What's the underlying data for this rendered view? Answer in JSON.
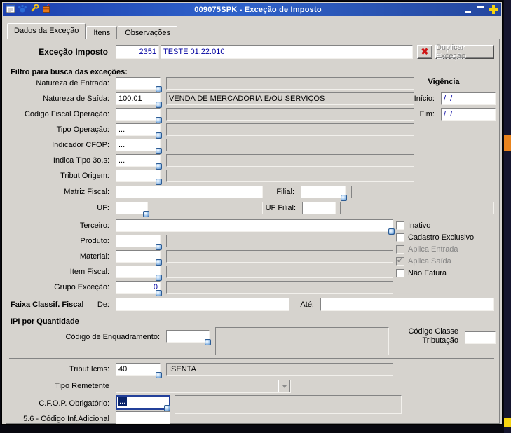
{
  "titlebar": {
    "title": "009075SPK - Exceção de Imposto"
  },
  "tabs": [
    {
      "label": "Dados da Exceção",
      "active": true
    },
    {
      "label": "Itens",
      "active": false
    },
    {
      "label": "Observações",
      "active": false
    }
  ],
  "header": {
    "label": "Exceção Imposto",
    "code": "2351",
    "description": "TESTE 01.22.010",
    "delete_icon": "✖",
    "duplicate_label": "Duplicar Exceção"
  },
  "sections": {
    "filtro": "Filtro para busca das exceções:",
    "vigencia": "Vigência",
    "faixa": "Faixa Classif. Fiscal",
    "ipi": "IPI por Quantidade"
  },
  "fields": {
    "natureza_entrada": {
      "label": "Natureza de Entrada:",
      "code": "",
      "desc": ""
    },
    "natureza_saida": {
      "label": "Natureza de Saída:",
      "code": "100.01",
      "desc": "VENDA DE MERCADORIA E/OU SERVIÇOS"
    },
    "inicio": {
      "label": "Início:",
      "value": "/  /"
    },
    "fim": {
      "label": "Fim:",
      "value": "/  /"
    },
    "codigo_fiscal_operacao": {
      "label": "Código Fiscal Operação:",
      "code": "",
      "desc": ""
    },
    "tipo_operacao": {
      "label": "Tipo Operação:",
      "code": "...",
      "desc": ""
    },
    "indicador_cfop": {
      "label": "Indicador CFOP:",
      "code": "...",
      "desc": ""
    },
    "indica_tipo_3os": {
      "label": "Indica Tipo 3o.s:",
      "code": "...",
      "desc": ""
    },
    "tribut_origem": {
      "label": "Tribut Origem:",
      "code": "",
      "desc": ""
    },
    "matriz_fiscal": {
      "label": "Matriz Fiscal:",
      "value": ""
    },
    "filial": {
      "label": "Filial:",
      "code": "",
      "desc": ""
    },
    "uf": {
      "label": "UF:",
      "code": "",
      "desc": ""
    },
    "uf_filial": {
      "label": "UF Filial:",
      "code": "",
      "desc": ""
    },
    "terceiro": {
      "label": "Terceiro:",
      "value": ""
    },
    "produto": {
      "label": "Produto:",
      "code": "",
      "desc": ""
    },
    "material": {
      "label": "Material:",
      "code": "",
      "desc": ""
    },
    "item_fiscal": {
      "label": "Item Fiscal:",
      "code": "",
      "desc": ""
    },
    "grupo_excecao": {
      "label": "Grupo Exceção:",
      "code": "0",
      "desc": ""
    },
    "faixa_de": {
      "label": "De:",
      "value": ""
    },
    "faixa_ate": {
      "label": "Até:",
      "value": ""
    },
    "codigo_enquadramento": {
      "label": "Código de Enquadramento:",
      "code": "",
      "desc": ""
    },
    "codigo_classe_tributacao": {
      "label": "Código Classe Tributação",
      "value": ""
    },
    "tribut_icms": {
      "label": "Tribut Icms:",
      "code": "40",
      "desc": "ISENTA"
    },
    "tipo_remetente": {
      "label": "Tipo Remetente",
      "value": ""
    },
    "cfop_obrigatorio": {
      "label": "C.F.O.P. Obrigatório:",
      "code": "...",
      "desc": ""
    },
    "codigo_inf_adicional": {
      "label": "5.6 - Código Inf.Adicional",
      "value": ""
    }
  },
  "checkboxes": [
    {
      "label": "Inativo",
      "checked": false,
      "disabled": false
    },
    {
      "label": "Cadastro Exclusivo",
      "checked": false,
      "disabled": false
    },
    {
      "label": "Aplica Entrada",
      "checked": false,
      "disabled": true
    },
    {
      "label": "Aplica Saída",
      "checked": true,
      "disabled": true
    },
    {
      "label": "Não Fatura",
      "checked": false,
      "disabled": false
    }
  ],
  "colors": {
    "titlebar_blue": "#2f62ca",
    "value_text_blue": "#0000a0",
    "selection_navy": "#0a246a",
    "delete_red": "#cf1414",
    "accent_orange": "#e8831d",
    "accent_yellow": "#f6d411",
    "chrome_gray": "#d6d3ce"
  },
  "icons": [
    "form-icon",
    "paw-icon",
    "wrench-icon",
    "package-icon",
    "minimize-icon",
    "maximize-icon",
    "plus-icon",
    "lookup-icon",
    "dropdown-arrow-icon"
  ]
}
